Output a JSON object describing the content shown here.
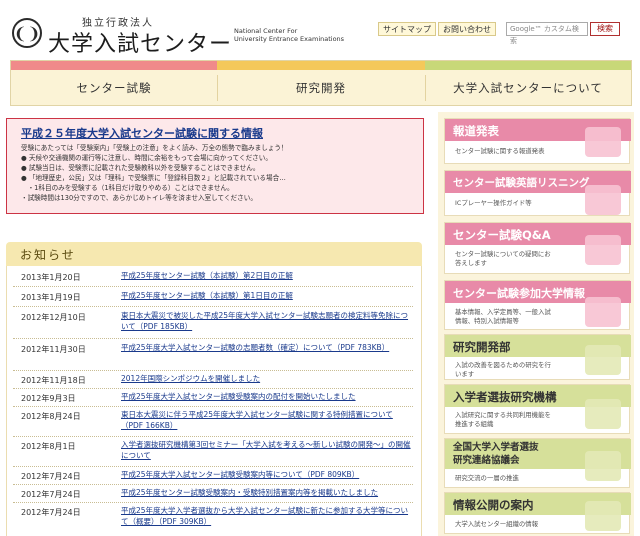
{
  "header": {
    "org_type": "独立行政法人",
    "org_name": "大学入試センター",
    "org_en_1": "National Center For",
    "org_en_2": "University Entrance Examinations",
    "sitemap_label": "サイトマップ",
    "contact_label": "お問い合わせ",
    "search_placeholder": "Google™ カスタム検索",
    "search_button": "検索",
    "logo_icon": "twin-arc-emblem"
  },
  "nav": {
    "items": [
      {
        "label": "センター試験"
      },
      {
        "label": "研究開発"
      },
      {
        "label": "大学入試センターについて"
      }
    ],
    "stripe_colors": [
      "#f08a8a",
      "#f4c85a",
      "#c8d878"
    ]
  },
  "notice": {
    "title": "平成２５年度大学入試センター試験に関する情報",
    "lines": [
      "受験にあたっては「受験案内」「受験上の注意」をよく読み、万全の態勢で臨みましょう！",
      "● 天候や交通機関の運行等に注意し、時間に余裕をもって会場に向かってください。",
      "● 試験当日は、受験票に記載された受験教科以外を受験することはできません。",
      "● 「地理歴史，公民」又は「理科」で受験票に「登録科目数２」と記載されている場合…",
      "　・1科目のみを受験する（1科目だけ取りやめる）ことはできません。",
      "・試験時間は130分ですので、あらかじめトイレ等を済ませ入室してください。"
    ]
  },
  "news": {
    "heading": "お知らせ",
    "items": [
      {
        "date": "2013年1月20日",
        "text": "平成25年度センター試験（本試験）第2日目の正解"
      },
      {
        "date": "2013年1月19日",
        "text": "平成25年度センター試験（本試験）第1日目の正解"
      },
      {
        "date": "2012年12月10日",
        "text": "東日本大震災で被災した平成25年度大学入試センター試験志願者の検定料等免除について（PDF 185KB）"
      },
      {
        "date": "2012年11月30日",
        "text": "平成25年度大学入試センター試験の志願者数（確定）について（PDF 783KB）"
      },
      {
        "date": "2012年11月18日",
        "text": "2012年国際シンポジウムを開催しました"
      },
      {
        "date": "2012年9月3日",
        "text": "平成25年度大学入試センター試験受験案内の配付を開始いたしました"
      },
      {
        "date": "2012年8月24日",
        "text": "東日本大震災に伴う平成25年度大学入試センター試験に関する特例措置について（PDF 166KB）"
      },
      {
        "date": "2012年8月1日",
        "text": "入学者選抜研究機構第3回セミナー「大学入試を考える～新しい試験の開発～」の開催について"
      },
      {
        "date": "2012年7月24日",
        "text": "平成25年度大学入試センター試験受験案内等について（PDF 809KB）"
      },
      {
        "date": "2012年7月24日",
        "text": "平成25年度センター試験受験案内・受験特別措置案内等を掲載いたしました"
      },
      {
        "date": "2012年7月24日",
        "text": "平成25年度大学入学者選抜から大学入試センター試験に新たに参加する大学等について（概要）（PDF 309KB）"
      }
    ]
  },
  "sidebar": {
    "cards": [
      {
        "title": "報道発表",
        "desc": "センター試験に関する報道発表",
        "bar_color": "#e88aa8"
      },
      {
        "title": "センター試験英語リスニング",
        "desc": "ICプレーヤー操作ガイド等",
        "bar_color": "#e88aa8"
      },
      {
        "title": "センター試験Q&A",
        "desc": "センター試験についての疑問にお答えします",
        "bar_color": "#e88aa8"
      },
      {
        "title": "センター試験参加大学情報",
        "desc": "基本情報、入学定員等、一般入試情報、特別入試情報等",
        "bar_color": "#e88aa8"
      },
      {
        "title": "研究開発部",
        "desc": "入試の改善を図るための研究を行います",
        "bar_color": "#d6e09a"
      },
      {
        "title": "入学者選抜研究機構",
        "desc": "入試研究に関する共同利用機能を推進する組織",
        "bar_color": "#d6e09a"
      },
      {
        "title": "全国大学入学者選抜研究連絡協議会",
        "title_1": "全国大学入学者選抜",
        "title_2": "研究連絡協議会",
        "desc": "研究交流の一層の推進",
        "bar_color": "#d6e09a"
      },
      {
        "title": "情報公開の案内",
        "desc": "大学入試センター組織の情報",
        "bar_color": "#d6e09a"
      }
    ]
  }
}
